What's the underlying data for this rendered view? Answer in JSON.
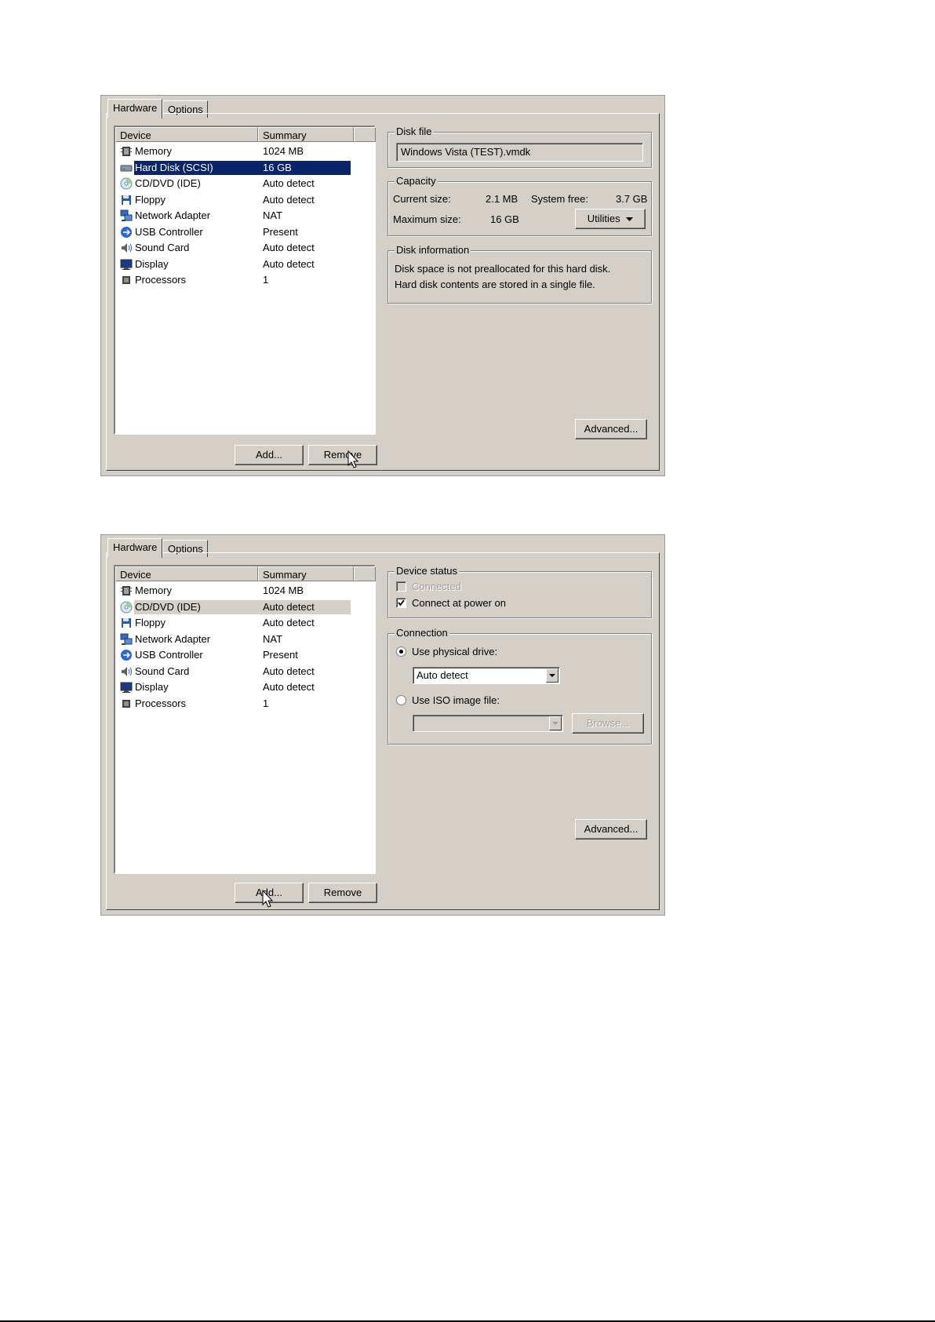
{
  "tabs": {
    "hardware": "Hardware",
    "options": "Options"
  },
  "list_headers": {
    "device": "Device",
    "summary": "Summary"
  },
  "dialog1": {
    "devices": [
      {
        "name": "Memory",
        "summary": "1024 MB",
        "icon": "memory-icon"
      },
      {
        "name": "Hard Disk (SCSI)",
        "summary": "16 GB",
        "icon": "hard-disk-icon"
      },
      {
        "name": "CD/DVD (IDE)",
        "summary": "Auto detect",
        "icon": "cd-dvd-icon"
      },
      {
        "name": "Floppy",
        "summary": "Auto detect",
        "icon": "floppy-icon"
      },
      {
        "name": "Network Adapter",
        "summary": "NAT",
        "icon": "network-adapter-icon"
      },
      {
        "name": "USB Controller",
        "summary": "Present",
        "icon": "usb-icon"
      },
      {
        "name": "Sound Card",
        "summary": "Auto detect",
        "icon": "sound-card-icon"
      },
      {
        "name": "Display",
        "summary": "Auto detect",
        "icon": "display-icon"
      },
      {
        "name": "Processors",
        "summary": "1",
        "icon": "processor-icon"
      }
    ],
    "disk_file": {
      "title": "Disk file",
      "value": "Windows Vista (TEST).vmdk"
    },
    "capacity": {
      "title": "Capacity",
      "current_label": "Current size:",
      "current_value": "2.1 MB",
      "free_label": "System free:",
      "free_value": "3.7 GB",
      "max_label": "Maximum size:",
      "max_value": "16 GB",
      "utilities_label": "Utilities"
    },
    "disk_info": {
      "title": "Disk information",
      "line1": "Disk space is not preallocated for this hard disk.",
      "line2": "Hard disk contents are stored in a single file."
    },
    "advanced_label": "Advanced...",
    "add_label": "Add...",
    "remove_label": "Remove"
  },
  "dialog2": {
    "devices": [
      {
        "name": "Memory",
        "summary": "1024 MB",
        "icon": "memory-icon"
      },
      {
        "name": "CD/DVD (IDE)",
        "summary": "Auto detect",
        "icon": "cd-dvd-icon"
      },
      {
        "name": "Floppy",
        "summary": "Auto detect",
        "icon": "floppy-icon"
      },
      {
        "name": "Network Adapter",
        "summary": "NAT",
        "icon": "network-adapter-icon"
      },
      {
        "name": "USB Controller",
        "summary": "Present",
        "icon": "usb-icon"
      },
      {
        "name": "Sound Card",
        "summary": "Auto detect",
        "icon": "sound-card-icon"
      },
      {
        "name": "Display",
        "summary": "Auto detect",
        "icon": "display-icon"
      },
      {
        "name": "Processors",
        "summary": "1",
        "icon": "processor-icon"
      }
    ],
    "device_status": {
      "title": "Device status",
      "connected": "Connected",
      "connect_power_on": "Connect at power on"
    },
    "connection": {
      "title": "Connection",
      "physical_label": "Use physical drive:",
      "physical_value": "Auto detect",
      "iso_label": "Use ISO image file:",
      "iso_value": "",
      "browse_label": "Browse..."
    },
    "advanced_label": "Advanced...",
    "add_label": "Add...",
    "remove_label": "Remove"
  }
}
